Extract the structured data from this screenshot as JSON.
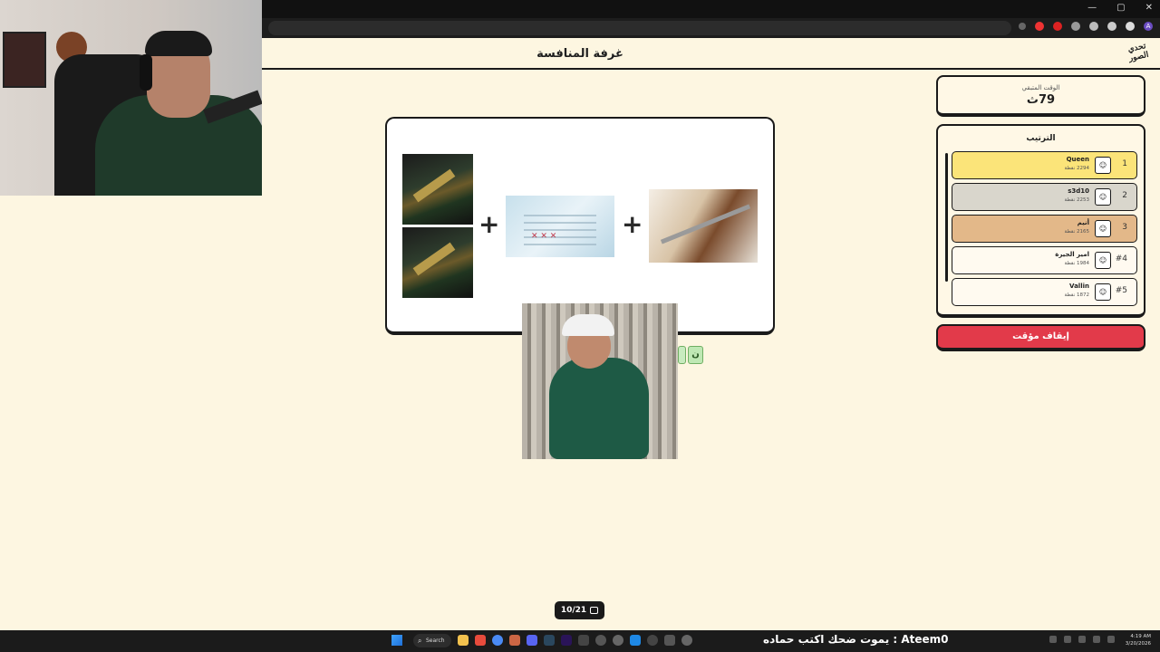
{
  "browser": {
    "window_controls": [
      "—",
      "▢",
      "✕"
    ],
    "profile_initial": "A"
  },
  "page": {
    "title": "غرفة المنافسة",
    "logo_text": "تحدي الصور"
  },
  "puzzle": {
    "operator": "+"
  },
  "answer_tiles": [
    "",
    "ن"
  ],
  "timer": {
    "label": "الوقت المتبقي",
    "value": "79ث"
  },
  "ranking": {
    "title": "الترتيب",
    "players": [
      {
        "position": "1",
        "name": "Queen",
        "points": "2294 نقطة",
        "color": "#fbe479"
      },
      {
        "position": "2",
        "name": "s3d10",
        "points": "2253 نقطة",
        "color": "#d9d6cc"
      },
      {
        "position": "3",
        "name": "أنيم",
        "points": "2165 نقطة",
        "color": "#e3b889"
      },
      {
        "position": "#4",
        "name": "امير الجيرة",
        "points": "1984 نقطة",
        "color": "#fffaf0"
      },
      {
        "position": "#5",
        "name": "Vallin",
        "points": "1872 نقطة",
        "color": "#fffaf0"
      }
    ]
  },
  "stop_button": {
    "label": "إيقاف مؤقت"
  },
  "progress": {
    "text": "10/21"
  },
  "taskbar": {
    "search_label": "Search",
    "ticker": "يموت ضحك اكتب حماده : Ateem0",
    "clock_time": "4:19 AM",
    "clock_date": "3/20/2026"
  }
}
